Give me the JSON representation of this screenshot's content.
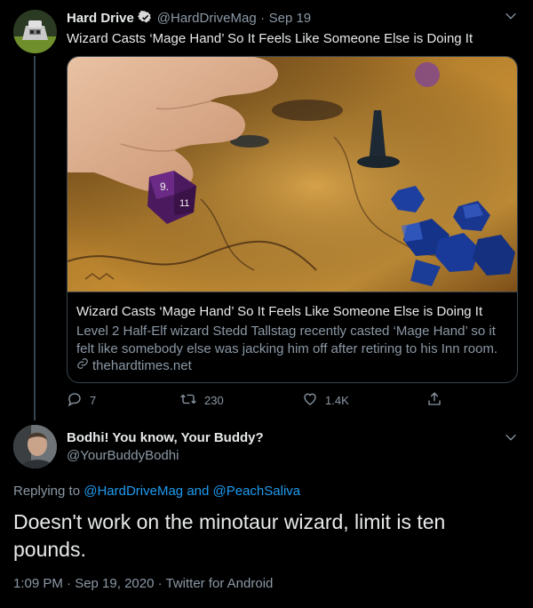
{
  "tweet1": {
    "display_name": "Hard Drive",
    "handle": "@HardDriveMag",
    "separator": "·",
    "date": "Sep 19",
    "text": "Wizard Casts ‘Mage Hand’ So It Feels Like Someone Else is Doing It",
    "card": {
      "title": "Wizard Casts ‘Mage Hand’ So It Feels Like Someone Else is Doing It",
      "description": "Level 2 Half-Elf wizard Stedd Tallstag recently casted ‘Mage Hand’ so it felt like somebody else was jacking him off after retiring to his Inn room.",
      "domain": "thehardtimes.net"
    },
    "actions": {
      "replies": "7",
      "retweets": "230",
      "likes": "1.4K"
    }
  },
  "tweet2": {
    "display_name": "Bodhi! You know, Your Buddy?",
    "handle": "@YourBuddyBodhi",
    "replying_prefix": "Replying to",
    "replying_user1": "@HardDriveMag",
    "replying_and": "and",
    "replying_user2": "@PeachSaliva",
    "text": "Doesn't work on the minotaur wizard, limit is ten pounds.",
    "time": "1:09 PM · Sep 19, 2020 · Twitter for Android"
  },
  "colors": {
    "background": "#000000",
    "primary_text": "#e7e9ea",
    "secondary_text": "#8b98a5",
    "link": "#1d9bf0",
    "border": "#38444d"
  },
  "icons": [
    "verified-icon",
    "chevron-down-icon",
    "reply-icon",
    "retweet-icon",
    "like-icon",
    "share-icon",
    "link-icon"
  ]
}
